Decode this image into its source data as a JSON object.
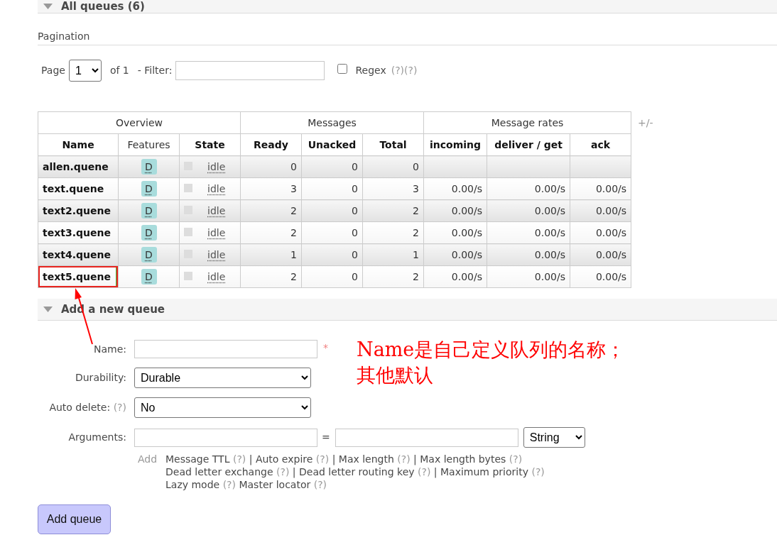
{
  "all_queues": {
    "title": "All queues (6)",
    "expanded": true
  },
  "pagination": {
    "heading": "Pagination",
    "page_label": "Page",
    "page": "1",
    "of_label": "of 1",
    "filter_label": "- Filter:",
    "regex": {
      "label": "Regex",
      "checked": false,
      "help": [
        "(?)",
        "(?)"
      ]
    }
  },
  "queues_table": {
    "groups": [
      {
        "label": "Overview",
        "columns": [
          {
            "label": "Name",
            "sortable": true
          },
          {
            "label": "Features",
            "sortable": false
          },
          {
            "label": "State",
            "sortable": true
          }
        ]
      },
      {
        "label": "Messages",
        "columns": [
          {
            "label": "Ready",
            "sortable": true
          },
          {
            "label": "Unacked",
            "sortable": true
          },
          {
            "label": "Total",
            "sortable": true
          }
        ]
      },
      {
        "label": "Message rates",
        "columns": [
          {
            "label": "incoming",
            "sortable": true
          },
          {
            "label": "deliver / get",
            "sortable": true
          },
          {
            "label": "ack",
            "sortable": true
          }
        ]
      }
    ],
    "column_toggle": "+/-",
    "rows": [
      {
        "name": "allen.quene",
        "features": [
          "D"
        ],
        "state": "idle",
        "messages": [
          "0",
          "0",
          "0"
        ],
        "highlighted": false
      },
      {
        "name": "text.quene",
        "features": [
          "D"
        ],
        "state": "idle",
        "messages": [
          "3",
          "0",
          "3"
        ],
        "rates": [
          "0.00/s",
          "0.00/s",
          "0.00/s"
        ],
        "highlighted": false
      },
      {
        "name": "text2.quene",
        "features": [
          "D"
        ],
        "state": "idle",
        "messages": [
          "2",
          "0",
          "2"
        ],
        "rates": [
          "0.00/s",
          "0.00/s",
          "0.00/s"
        ],
        "highlighted": false
      },
      {
        "name": "text3.quene",
        "features": [
          "D"
        ],
        "state": "idle",
        "messages": [
          "2",
          "0",
          "2"
        ],
        "rates": [
          "0.00/s",
          "0.00/s",
          "0.00/s"
        ],
        "highlighted": false
      },
      {
        "name": "text4.quene",
        "features": [
          "D"
        ],
        "state": "idle",
        "messages": [
          "1",
          "0",
          "1"
        ],
        "rates": [
          "0.00/s",
          "0.00/s",
          "0.00/s"
        ],
        "highlighted": false
      },
      {
        "name": "text5.quene",
        "features": [
          "D"
        ],
        "state": "idle",
        "messages": [
          "2",
          "0",
          "2"
        ],
        "rates": [
          "0.00/s",
          "0.00/s",
          "0.00/s"
        ],
        "highlighted": true
      }
    ]
  },
  "add_queue": {
    "title": "Add a new queue",
    "expanded": true,
    "fields": [
      {
        "kind": "text",
        "label": "Name:",
        "required_mark": "*"
      },
      {
        "kind": "select",
        "label": "Durability:",
        "value": "Durable"
      },
      {
        "kind": "select",
        "label": "Auto delete:",
        "help": "(?)",
        "value": "No"
      },
      {
        "kind": "pair",
        "label": "Arguments:",
        "separator": "=",
        "type": "String"
      }
    ],
    "add_label": "Add",
    "argument_links": [
      [
        {
          "kind": "link",
          "text": "Message TTL"
        },
        {
          "kind": "help",
          "text": "(?)"
        },
        {
          "kind": "separator",
          "text": "|"
        },
        {
          "kind": "link",
          "text": "Auto expire"
        },
        {
          "kind": "help",
          "text": "(?)"
        },
        {
          "kind": "separator",
          "text": "|"
        },
        {
          "kind": "link",
          "text": "Max length"
        },
        {
          "kind": "help",
          "text": "(?)"
        },
        {
          "kind": "separator",
          "text": "|"
        },
        {
          "kind": "link",
          "text": "Max length bytes"
        },
        {
          "kind": "help",
          "text": "(?)"
        }
      ],
      [
        {
          "kind": "link",
          "text": "Dead letter exchange"
        },
        {
          "kind": "help",
          "text": "(?)"
        },
        {
          "kind": "separator",
          "text": "|"
        },
        {
          "kind": "link",
          "text": "Dead letter routing key"
        },
        {
          "kind": "help",
          "text": "(?)"
        },
        {
          "kind": "separator",
          "text": "|"
        },
        {
          "kind": "link",
          "text": "Maximum priority"
        },
        {
          "kind": "help",
          "text": "(?)"
        }
      ],
      [
        {
          "kind": "link",
          "text": "Lazy mode"
        },
        {
          "kind": "help",
          "text": "(?)"
        },
        {
          "kind": "link",
          "text": "Master locator"
        },
        {
          "kind": "help",
          "text": "(?)"
        }
      ]
    ],
    "submit": "Add queue"
  },
  "annotation": {
    "lines": [
      "Name是自己定义队列的名称；",
      "其他默认"
    ]
  }
}
